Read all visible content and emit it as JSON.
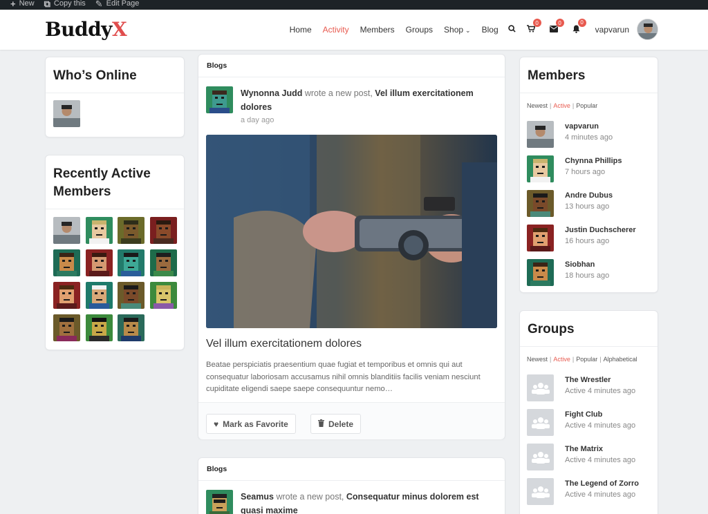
{
  "adminbar": {
    "items": [
      {
        "icon": "plus-icon",
        "label": "New"
      },
      {
        "icon": "copy-icon",
        "label": "Copy this"
      },
      {
        "icon": "pencil-icon",
        "label": "Edit Page"
      }
    ]
  },
  "header": {
    "logo_main": "Buddy",
    "logo_accent": "X",
    "nav": [
      "Home",
      "Activity",
      "Members",
      "Groups",
      "Shop",
      "Blog"
    ],
    "active_nav": "Activity",
    "cart_count": "0",
    "messages_count": "0",
    "notifications_count": "0",
    "username": "vapvarun"
  },
  "colors": {
    "accent": "#e85a4f",
    "admin_bar": "#1d2327",
    "page_bg": "#eef0f2"
  },
  "whos_online": {
    "title": "Who’s Online"
  },
  "recently_active": {
    "title": "Recently Active Members"
  },
  "feed": {
    "posts": [
      {
        "section": "Blogs",
        "author": "Wynonna Judd",
        "action_text": "wrote a new post,",
        "post_link": "Vel illum exercitationem dolores",
        "time": "a day ago",
        "title": "Vel illum exercitationem dolores",
        "excerpt": "Beatae perspiciatis praesentium quae fugiat et temporibus et omnis qui aut consequatur laboriosam accusamus nihil omnis blanditiis facilis veniam nesciunt cupiditate eligendi saepe saepe consequuntur nemo…",
        "favorite_label": "Mark as Favorite",
        "delete_label": "Delete"
      },
      {
        "section": "Blogs",
        "author": "Seamus",
        "action_text": "wrote a new post,",
        "post_link": "Consequatur minus dolorem est quasi maxime"
      }
    ]
  },
  "members_widget": {
    "title": "Members",
    "tabs": [
      "Newest",
      "Active",
      "Popular"
    ],
    "active_tab": "Active",
    "items": [
      {
        "name": "vapvarun",
        "time": "4 minutes ago"
      },
      {
        "name": "Chynna Phillips",
        "time": "7 hours ago"
      },
      {
        "name": "Andre Dubus",
        "time": "13 hours ago"
      },
      {
        "name": "Justin Duchscherer",
        "time": "16 hours ago"
      },
      {
        "name": "Siobhan",
        "time": "18 hours ago"
      }
    ]
  },
  "groups_widget": {
    "title": "Groups",
    "tabs": [
      "Newest",
      "Active",
      "Popular",
      "Alphabetical"
    ],
    "active_tab": "Active",
    "items": [
      {
        "name": "The Wrestler",
        "time": "Active 4 minutes ago"
      },
      {
        "name": "Fight Club",
        "time": "Active 4 minutes ago"
      },
      {
        "name": "The Matrix",
        "time": "Active 4 minutes ago"
      },
      {
        "name": "The Legend of Zorro",
        "time": "Active 4 minutes ago"
      }
    ]
  }
}
